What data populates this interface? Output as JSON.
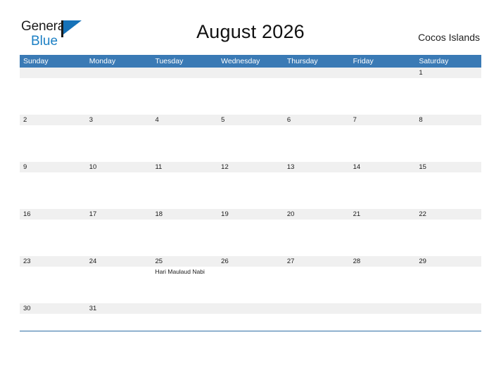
{
  "brand": {
    "word_one": "General",
    "word_two": "Blue",
    "flag_icon": "flag-icon",
    "accent_color": "#1672b8"
  },
  "header": {
    "title": "August 2026",
    "location": "Cocos Islands"
  },
  "colors": {
    "header_blue": "#3a7ab5",
    "row_line_blue": "#2e6da4",
    "date_band_gray": "#f0f0f0",
    "text_dark": "#1a1a1a"
  },
  "calendar": {
    "weekdays": [
      "Sunday",
      "Monday",
      "Tuesday",
      "Wednesday",
      "Thursday",
      "Friday",
      "Saturday"
    ],
    "weeks": [
      {
        "days": [
          "",
          "",
          "",
          "",
          "",
          "",
          "1"
        ],
        "events": [
          "",
          "",
          "",
          "",
          "",
          "",
          ""
        ]
      },
      {
        "days": [
          "2",
          "3",
          "4",
          "5",
          "6",
          "7",
          "8"
        ],
        "events": [
          "",
          "",
          "",
          "",
          "",
          "",
          ""
        ]
      },
      {
        "days": [
          "9",
          "10",
          "11",
          "12",
          "13",
          "14",
          "15"
        ],
        "events": [
          "",
          "",
          "",
          "",
          "",
          "",
          ""
        ]
      },
      {
        "days": [
          "16",
          "17",
          "18",
          "19",
          "20",
          "21",
          "22"
        ],
        "events": [
          "",
          "",
          "",
          "",
          "",
          "",
          ""
        ]
      },
      {
        "days": [
          "23",
          "24",
          "25",
          "26",
          "27",
          "28",
          "29"
        ],
        "events": [
          "",
          "",
          "Hari Maulaud Nabi",
          "",
          "",
          "",
          ""
        ]
      },
      {
        "days": [
          "30",
          "31",
          "",
          "",
          "",
          "",
          ""
        ],
        "events": [
          "",
          "",
          "",
          "",
          "",
          "",
          ""
        ]
      }
    ]
  }
}
